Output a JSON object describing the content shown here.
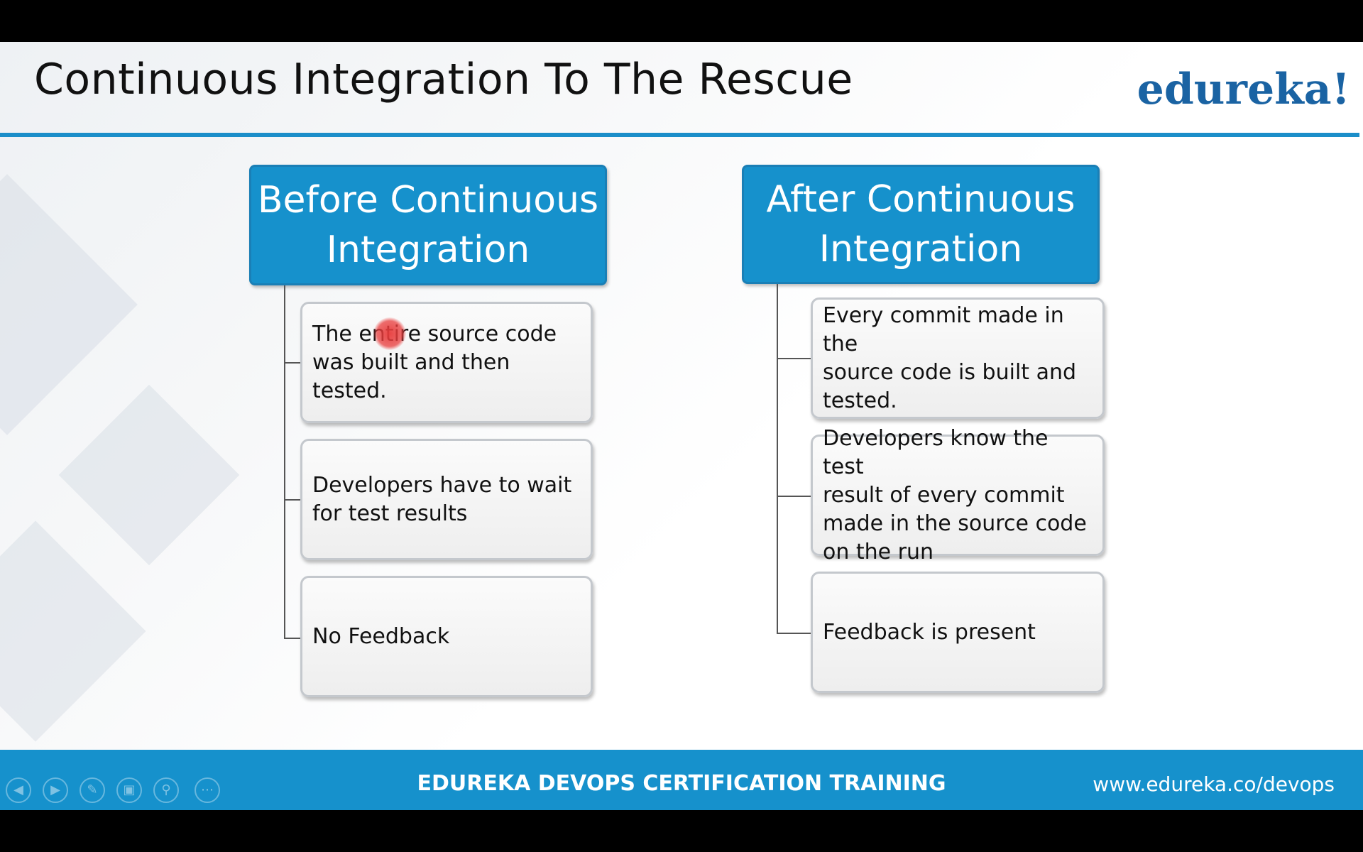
{
  "slide": {
    "title": "Continuous Integration To The Rescue",
    "logo": "edureka!"
  },
  "before": {
    "header_line1": "Before Continuous",
    "header_line2": "Integration",
    "items": [
      {
        "line1": "The entire source code",
        "line2": "was built and then tested."
      },
      {
        "line1": "Developers have to wait",
        "line2": "for test results"
      },
      {
        "line1": "No Feedback"
      }
    ]
  },
  "after": {
    "header_line1": "After Continuous",
    "header_line2": "Integration",
    "items": [
      {
        "line1": "Every commit made in the",
        "line2": "source code is built and",
        "line3": "tested."
      },
      {
        "line1": "Developers know the test",
        "line2": "result of every commit",
        "line3": "made in the source code",
        "line4": "on the run"
      },
      {
        "line1": "Feedback is present"
      }
    ]
  },
  "footer": {
    "title": "EDUREKA DEVOPS CERTIFICATION TRAINING",
    "url": "www.edureka.co/devops"
  },
  "controls": {
    "icons": [
      "previous-icon",
      "next-icon",
      "pen-icon",
      "slides-icon",
      "zoom-icon",
      "more-icon"
    ]
  },
  "colors": {
    "accent": "#1691cc",
    "logo": "#1a63a3",
    "pointer": "#e83c3c"
  }
}
